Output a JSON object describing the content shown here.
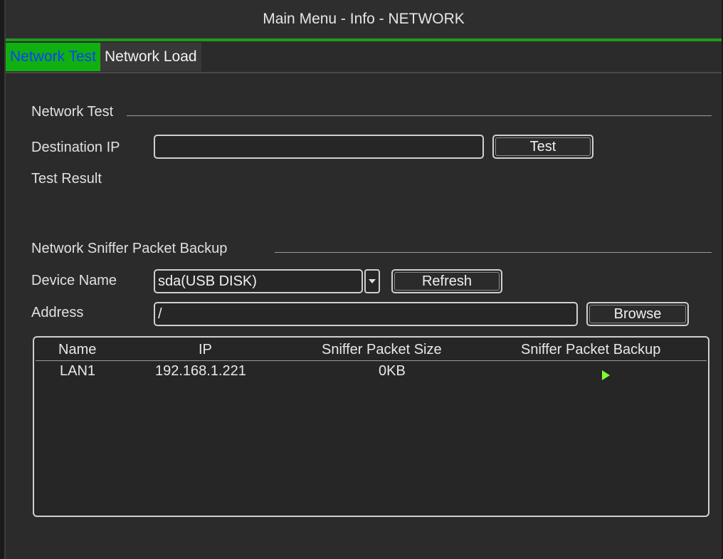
{
  "window": {
    "title": "Main Menu - Info - NETWORK"
  },
  "tabs": [
    {
      "label": "Network Test",
      "active": true
    },
    {
      "label": "Network Load",
      "active": false
    }
  ],
  "network_test": {
    "section_title": "Network Test",
    "destination_label": "Destination IP",
    "destination_value": "",
    "test_button": "Test",
    "result_label": "Test Result"
  },
  "sniffer": {
    "section_title": "Network Sniffer Packet Backup",
    "device_label": "Device Name",
    "device_value": "sda(USB DISK)",
    "refresh_button": "Refresh",
    "address_label": "Address",
    "address_value": "/",
    "browse_button": "Browse",
    "columns": [
      "Name",
      "IP",
      "Sniffer Packet Size",
      "Sniffer Packet Backup"
    ],
    "rows": [
      {
        "name": "LAN1",
        "ip": "192.168.1.221",
        "size": "0KB",
        "backup_icon": "play-icon"
      }
    ]
  },
  "colors": {
    "accent": "#1e9a1e",
    "active_tab_bg": "#10b010",
    "active_tab_text": "#1040ff",
    "play_icon": "#7cff33"
  }
}
